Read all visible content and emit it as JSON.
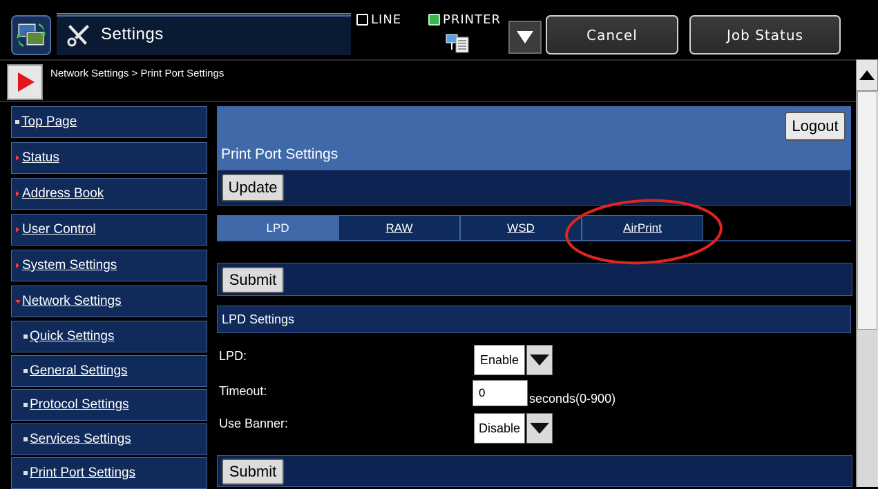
{
  "topbar": {
    "title": "Settings",
    "line_label": "LINE",
    "printer_label": "PRINTER",
    "cancel_label": "Cancel",
    "job_status_label": "Job Status"
  },
  "breadcrumb": "Network Settings > Print Port Settings",
  "sidebar": {
    "items": [
      {
        "label": "Top Page",
        "bullet": "square"
      },
      {
        "label": "Status",
        "bullet": "arrow"
      },
      {
        "label": "Address Book",
        "bullet": "arrow"
      },
      {
        "label": "User Control",
        "bullet": "arrow"
      },
      {
        "label": "System Settings",
        "bullet": "arrow"
      },
      {
        "label": "Network Settings",
        "bullet": "expanded"
      },
      {
        "label": "Quick Settings",
        "bullet": "square"
      },
      {
        "label": "General Settings",
        "bullet": "square"
      },
      {
        "label": "Protocol Settings",
        "bullet": "square"
      },
      {
        "label": "Services Settings",
        "bullet": "square"
      },
      {
        "label": "Print Port Settings",
        "bullet": "square"
      }
    ]
  },
  "main": {
    "logout_label": "Logout",
    "page_title": "Print Port Settings",
    "update_label": "Update",
    "tabs": [
      {
        "label": "LPD",
        "active": true
      },
      {
        "label": "RAW",
        "active": false
      },
      {
        "label": "WSD",
        "active": false
      },
      {
        "label": "AirPrint",
        "active": false
      }
    ],
    "submit_label": "Submit",
    "section_title": "LPD Settings",
    "fields": {
      "lpd": {
        "label": "LPD:",
        "value": "Enable"
      },
      "timeout": {
        "label": "Timeout:",
        "value": "0",
        "suffix": "seconds(0-900)"
      },
      "use_banner": {
        "label": "Use Banner:",
        "value": "Disable"
      }
    }
  },
  "colors": {
    "panel_blue": "#4069aa",
    "dark_navy": "#102a5a",
    "annotation_red": "#e0251f"
  }
}
